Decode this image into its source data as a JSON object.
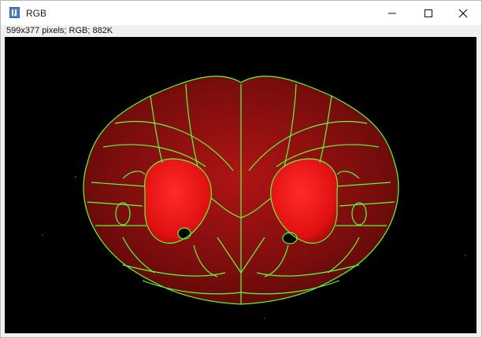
{
  "window": {
    "title": "RGB",
    "icon": "imagej-icon",
    "controls": [
      "minimize-icon",
      "maximize-icon",
      "close-icon"
    ]
  },
  "image_info": "599x377 pixels; RGB; 882K",
  "image": {
    "subject": "coronal-brain-section",
    "colors": {
      "background": "#000000",
      "tissue": "#8b0f0f",
      "tissue_bright": "#ff1a1a",
      "atlas_outline": "#5cff3a"
    }
  }
}
